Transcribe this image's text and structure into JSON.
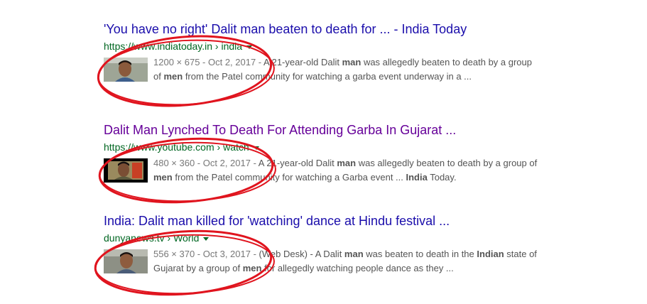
{
  "results": [
    {
      "title": "'You have no right' Dalit man beaten to death for ... - India Today",
      "url_host": "https://www.indiatoday.in",
      "url_sep": " › ",
      "url_path": "india",
      "meta": "1200 × 675 - Oct 2, 2017 - ",
      "snippet": {
        "t1": "A 21-year-old Dalit ",
        "b1": "man",
        "t2": " was allegedly beaten to death by a group of ",
        "b2": "men",
        "t3": " from the Patel community for watching a garba event underway in a ..."
      }
    },
    {
      "title": "Dalit Man Lynched To Death For Attending Garba In Gujarat ...",
      "url_host": "https://www.youtube.com",
      "url_sep": " › ",
      "url_path": "watch",
      "meta": "480 × 360 - Oct 2, 2017 - ",
      "snippet": {
        "t1": "A 21-year-old Dalit ",
        "b1": "man",
        "t2": " was allegedly beaten to death by a group of ",
        "b2": "men",
        "t3": " from the Patel community for watching a Garba event ... ",
        "b3": "India",
        "t4": " Today."
      }
    },
    {
      "title": "India: Dalit man killed for 'watching' dance at Hindu festival ...",
      "url_host": "dunyanews.tv",
      "url_sep": " › ",
      "url_path": "World",
      "meta": "556 × 370 - Oct 3, 2017 - ",
      "snippet": {
        "t1": "(Web Desk) - A Dalit ",
        "b1": "man",
        "t2": " was beaten to death in the ",
        "b2": "Indian",
        "t3": " state of Gujarat by a group of ",
        "b3": "men",
        "t4": " for allegedly watching people dance as they ..."
      }
    }
  ],
  "colors": {
    "title_link": "#1a0dab",
    "title_visited": "#660099",
    "url": "#006621",
    "snippet": "#545454",
    "annotation": "#e0141e"
  },
  "icons": [
    "thumbnail-image",
    "dropdown-caret-icon"
  ]
}
